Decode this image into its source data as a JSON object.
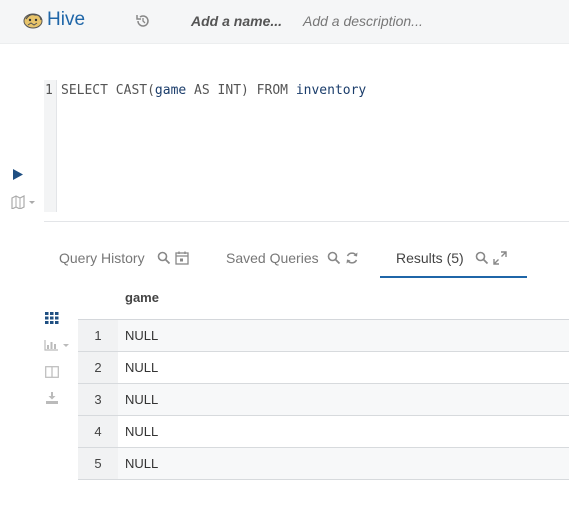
{
  "header": {
    "title": "Hive",
    "name_placeholder": "Add a name...",
    "description_placeholder": "Add a description..."
  },
  "editor": {
    "line_number": "1",
    "query": {
      "t1": "SELECT CAST(",
      "t2": "game",
      "t3": " AS INT) FROM ",
      "t4": "inventory"
    }
  },
  "tabs": [
    {
      "label": "Query History",
      "active": false
    },
    {
      "label": "Saved Queries",
      "active": false
    },
    {
      "label": "Results (5)",
      "active": true
    }
  ],
  "results": {
    "column": "game",
    "rows": [
      {
        "index": "1",
        "value": "NULL"
      },
      {
        "index": "2",
        "value": "NULL"
      },
      {
        "index": "3",
        "value": "NULL"
      },
      {
        "index": "4",
        "value": "NULL"
      },
      {
        "index": "5",
        "value": "NULL"
      }
    ]
  },
  "colors": {
    "accent": "#1f66a8",
    "header_bg": "#f5f6f7"
  },
  "icons": [
    "hive-logo-icon",
    "history-icon",
    "play-icon",
    "map-icon",
    "search-icon",
    "calendar-icon",
    "refresh-icon",
    "expand-icon",
    "grid-icon",
    "bar-chart-icon",
    "columns-icon",
    "download-icon"
  ]
}
